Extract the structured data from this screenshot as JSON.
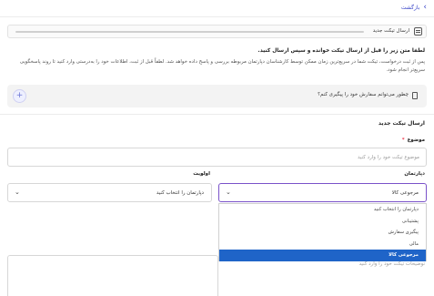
{
  "back_label": "بازگشت",
  "page_title": "ارسال تیکت جدید",
  "intro": {
    "bold": "لطفا متن زیر را قبل از ارسال تیکت خوانده و سپس ارسال کنید.",
    "body": "پس از ثبت درخواست، تیکت شما در سریع‌ترین زمان ممکن توسط کارشناسان دپارتمان مربوطه بررسی و پاسخ داده خواهد شد. لطفاً قبل از ثبت، اطلاعات خود را به‌درستی وارد کنید تا روند پاسخگویی سریع‌تر انجام شود."
  },
  "faq": {
    "question": "چطور می‌توانم سفارش خود را پیگیری کنم؟",
    "plus": "+"
  },
  "form": {
    "title": "ارسال تیکت جدید",
    "subject_label": "موضوع",
    "subject_required_mark": "*",
    "subject_placeholder": "موضوع تیکت خود را وارد کنید",
    "department_label": "دپارتمان",
    "department_value": "مرجوعی کالا",
    "priority_label": "اولویت",
    "priority_value": "دپارتمان را انتخاب کنید",
    "description_placeholder": "توضیحات تیکت خود را وارد کنید",
    "department_options": [
      "دپارتمان را انتخاب کنید",
      "پشتیبانی",
      "پیگیری سفارش",
      "مالی",
      "مرجوعی کالا"
    ],
    "department_selected_index": 4
  },
  "colors": {
    "accent": "#3a46c8",
    "focus_border": "#7a52c9",
    "selected_option": "#1f64c8"
  }
}
